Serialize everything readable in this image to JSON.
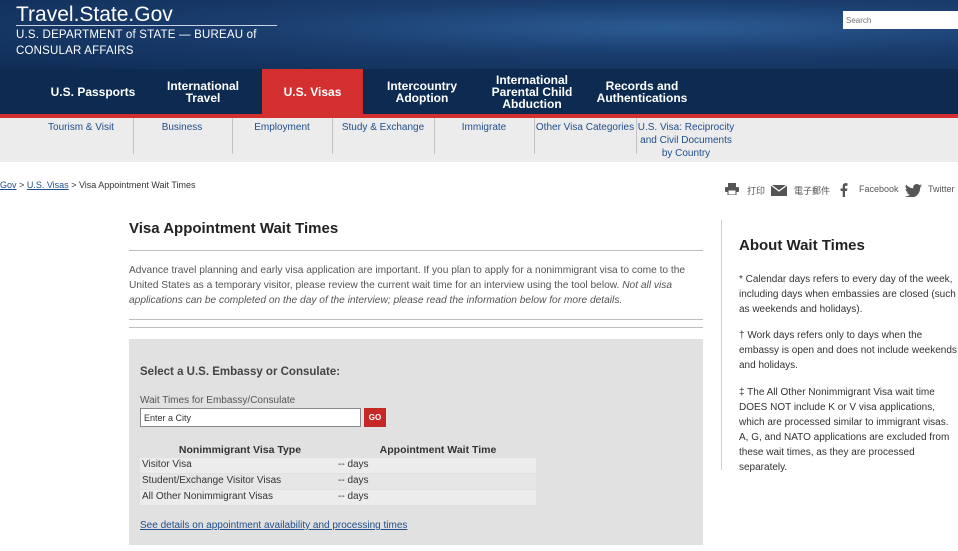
{
  "header": {
    "site_title": "Travel.State.Gov",
    "dept_line1": "U.S. DEPARTMENT of STATE — BUREAU of",
    "dept_line2": "CONSULAR AFFAIRS",
    "search_placeholder": "Search"
  },
  "main_nav": [
    {
      "label": "U.S. Passports",
      "active": false
    },
    {
      "label": "International Travel",
      "active": false
    },
    {
      "label": "U.S. Visas",
      "active": true
    },
    {
      "label": "Intercountry Adoption",
      "active": false
    },
    {
      "label": "International Parental Child Abduction",
      "active": false
    },
    {
      "label": "Records and Authentications",
      "active": false
    }
  ],
  "sub_nav": [
    "Tourism & Visit",
    "Business",
    "Employment",
    "Study & Exchange",
    "Immigrate",
    "Other Visa Categories",
    "U.S. Visa: Reciprocity and Civil Documents by Country"
  ],
  "breadcrumb": {
    "home_fragment": "Gov",
    "sep": ">",
    "visas": "U.S. Visas",
    "current": "> Visa Appointment Wait Times"
  },
  "share": {
    "print": "打印",
    "email": "電子郵件",
    "facebook": "Facebook",
    "twitter": "Twitter"
  },
  "main": {
    "title": "Visa Appointment Wait Times",
    "intro_plain": "Advance travel planning and early visa application are important. If you plan to apply for a nonimmigrant visa to come to the United States as a temporary visitor, please review the current wait time for an interview using the tool below. ",
    "intro_italic": "Not all visa applications can be completed on the day of the interview; please read the information below for more details."
  },
  "tool": {
    "heading": "Select a U.S. Embassy or Consulate:",
    "label": "Wait Times for Embassy/Consulate",
    "input_value": "Enter a City",
    "go_label": "GO",
    "col_type": "Nonimmigrant Visa Type",
    "col_wait": "Appointment Wait Time",
    "rows": [
      {
        "type": "Visitor Visa",
        "wait": "-- days"
      },
      {
        "type": "Student/Exchange Visitor Visas",
        "wait": "-- days"
      },
      {
        "type": "All Other Nonimmigrant Visas",
        "wait": "-- days"
      }
    ],
    "details_link": "See details on appointment availability and processing times"
  },
  "sidebar": {
    "title": "About Wait Times",
    "p1": "* Calendar days refers to every day of the week, including days when embassies are closed (such as weekends and holidays).",
    "p2": "† Work days refers only to days when the embassy is open and does not include weekends and holidays.",
    "p3": "‡ The All Other Nonimmigrant Visa wait time DOES NOT include K or V visa applications, which are processed similar to immigrant visas.  A, G, and NATO applications are excluded from these wait times, as they are processed separately."
  },
  "colors": {
    "header_blue": "#1a3d6e",
    "nav_navy": "#0d2b50",
    "accent_red": "#d32f2f",
    "link_blue": "#1f4e8c"
  }
}
